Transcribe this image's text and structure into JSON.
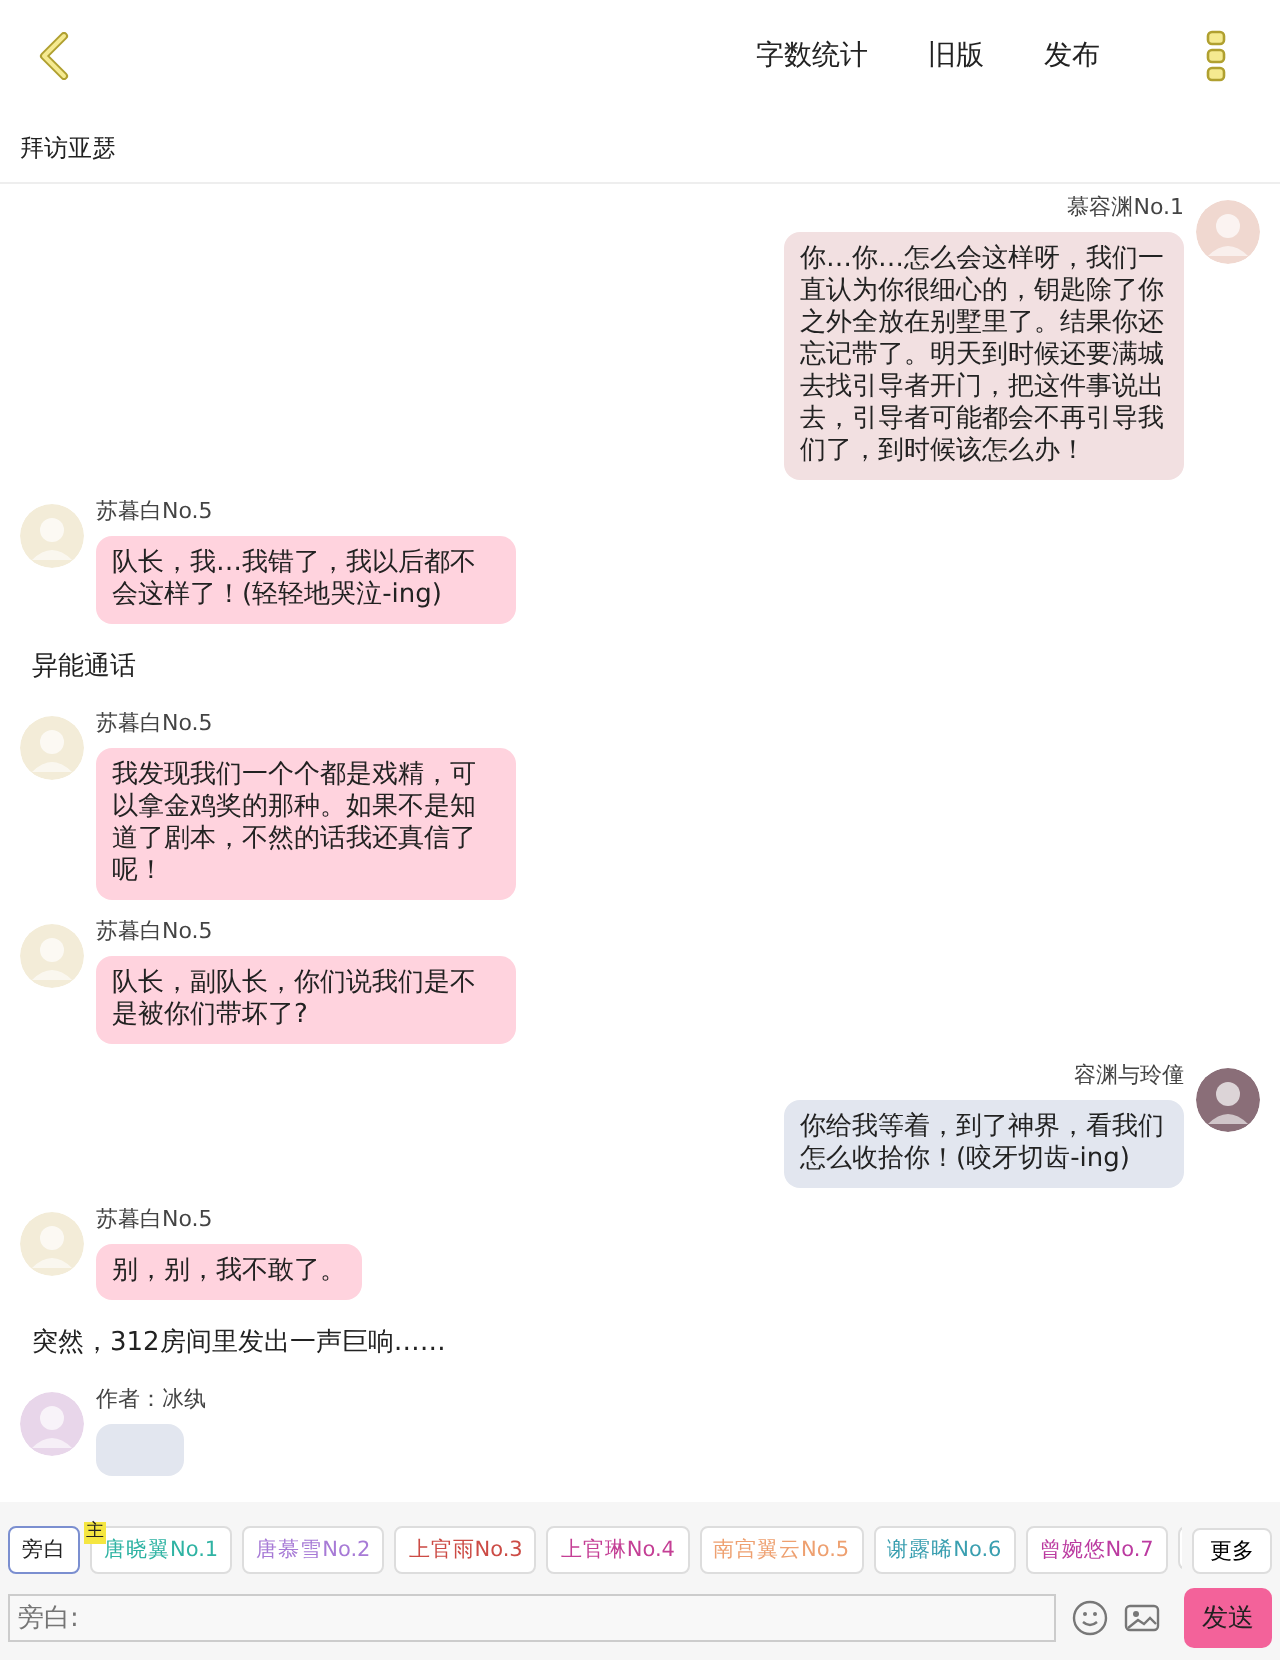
{
  "header": {
    "actions": [
      "字数统计",
      "旧版",
      "发布"
    ]
  },
  "title": "拜访亚瑟",
  "messages": [
    {
      "kind": "right",
      "name": "慕容渊No.1",
      "text": "你…你…怎么会这样呀，我们一直认为你很细心的，钥匙除了你之外全放在别墅里了。结果你还忘记带了。明天到时候还要满城去找引导者开门，把这件事说出去，引导者可能都会不再引导我们了，到时候该怎么办！",
      "color": "#f2e0e1"
    },
    {
      "kind": "left",
      "name": "苏暮白No.5",
      "text": "队长，我…我错了，我以后都不会这样了！(轻轻地哭泣-ing)",
      "color": "#ffd3de"
    },
    {
      "kind": "narration",
      "text": "异能通话"
    },
    {
      "kind": "left",
      "name": "苏暮白No.5",
      "text": "我发现我们一个个都是戏精，可以拿金鸡奖的那种。如果不是知道了剧本，不然的话我还真信了呢！",
      "color": "#ffd3de"
    },
    {
      "kind": "left",
      "name": "苏暮白No.5",
      "text": "队长，副队长，你们说我们是不是被你们带坏了?",
      "color": "#ffd3de"
    },
    {
      "kind": "right",
      "name": "容渊与玲僮",
      "text": "你给我等着，到了神界，看我们怎么收拾你！(咬牙切齿-ing)",
      "color": "#e2e6ef"
    },
    {
      "kind": "left",
      "name": "苏暮白No.5",
      "text": "别，别，我不敢了。",
      "color": "#ffd3de"
    },
    {
      "kind": "narration",
      "text": "突然，312房间里发出一声巨响……"
    },
    {
      "kind": "left",
      "name": "作者：冰纨",
      "color": "#e2e6ef"
    }
  ],
  "roles": [
    {
      "label": "旁白",
      "selected": true,
      "color": "#222222"
    },
    {
      "label": "唐晓翼No.1",
      "selected": false,
      "color": "#2fb3a3",
      "badge": "主"
    },
    {
      "label": "唐慕雪No.2",
      "selected": false,
      "color": "#a77ad6"
    },
    {
      "label": "上官雨No.3",
      "selected": false,
      "color": "#cc4b45"
    },
    {
      "label": "上官琳No.4",
      "selected": false,
      "color": "#c43f95"
    },
    {
      "label": "南宫翼云No.5",
      "selected": false,
      "color": "#eea070"
    },
    {
      "label": "谢露晞No.6",
      "selected": false,
      "color": "#3a9fb0"
    },
    {
      "label": "曾婉悠No.7",
      "selected": false,
      "color": "#bb3aa0"
    }
  ],
  "more": "更多",
  "input": {
    "placeholder": "旁白:"
  },
  "send": "发送"
}
